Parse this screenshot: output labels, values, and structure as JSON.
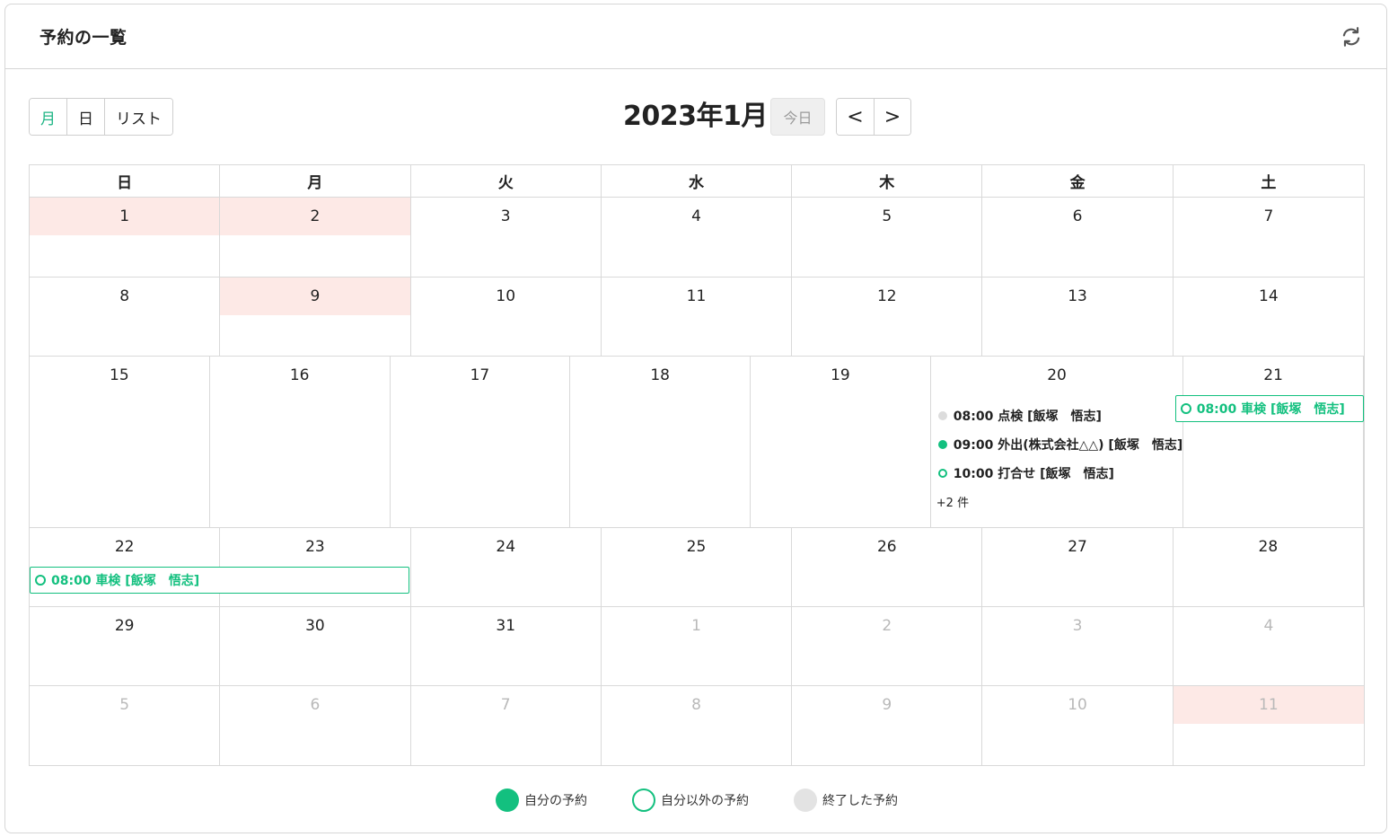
{
  "header": {
    "title": "予約の一覧",
    "refresh_icon": "refresh-icon"
  },
  "toolbar": {
    "views": [
      "月",
      "日",
      "リスト"
    ],
    "active_view": "月",
    "title": "2023年1月",
    "today": "今日",
    "prev": "<",
    "next": ">"
  },
  "calendar": {
    "weekdays": [
      "日",
      "月",
      "火",
      "水",
      "木",
      "金",
      "土"
    ],
    "weeks": [
      [
        {
          "d": "1",
          "holiday": true
        },
        {
          "d": "2",
          "holiday": true
        },
        {
          "d": "3"
        },
        {
          "d": "4"
        },
        {
          "d": "5"
        },
        {
          "d": "6"
        },
        {
          "d": "7"
        }
      ],
      [
        {
          "d": "8"
        },
        {
          "d": "9",
          "holiday": true
        },
        {
          "d": "10"
        },
        {
          "d": "11"
        },
        {
          "d": "12"
        },
        {
          "d": "13"
        },
        {
          "d": "14"
        }
      ],
      [
        {
          "d": "15"
        },
        {
          "d": "16"
        },
        {
          "d": "17"
        },
        {
          "d": "18"
        },
        {
          "d": "19"
        },
        {
          "d": "20"
        },
        {
          "d": "21"
        }
      ],
      [
        {
          "d": "22"
        },
        {
          "d": "23"
        },
        {
          "d": "24"
        },
        {
          "d": "25"
        },
        {
          "d": "26"
        },
        {
          "d": "27"
        },
        {
          "d": "28"
        }
      ],
      [
        {
          "d": "29"
        },
        {
          "d": "30"
        },
        {
          "d": "31"
        },
        {
          "d": "1",
          "other": true
        },
        {
          "d": "2",
          "other": true
        },
        {
          "d": "3",
          "other": true
        },
        {
          "d": "4",
          "other": true
        }
      ],
      [
        {
          "d": "5",
          "other": true
        },
        {
          "d": "6",
          "other": true
        },
        {
          "d": "7",
          "other": true
        },
        {
          "d": "8",
          "other": true
        },
        {
          "d": "9",
          "other": true
        },
        {
          "d": "10",
          "other": true
        },
        {
          "d": "11",
          "other": true,
          "holiday": true
        }
      ]
    ],
    "jan20_events": [
      {
        "text": "08:00 点検 [飯塚　悟志]",
        "kind": "ended"
      },
      {
        "text": "09:00 外出(株式会社△△) [飯塚　悟志]",
        "kind": "own"
      },
      {
        "text": "10:00 打合せ [飯塚　悟志]",
        "kind": "others"
      }
    ],
    "jan20_more": "+2 件",
    "bar_event_text": "08:00  車検 [飯塚　悟志]"
  },
  "legend": [
    {
      "label": "自分の予約",
      "kind": "own"
    },
    {
      "label": "自分以外の予約",
      "kind": "others"
    },
    {
      "label": "終了した予約",
      "kind": "ended"
    }
  ],
  "colors": {
    "accent": "#13c07f",
    "holiday_bg": "#fde9e6",
    "ended": "#dcdcdc"
  }
}
